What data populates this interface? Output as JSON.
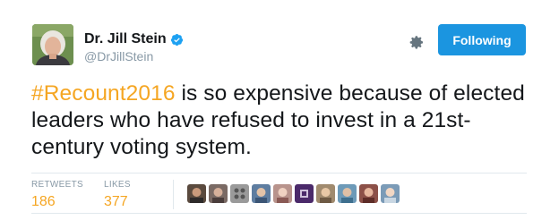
{
  "author": {
    "name": "Dr. Jill Stein",
    "handle": "@DrJillStein",
    "verified": true,
    "avatar_icon": "profile-photo"
  },
  "header": {
    "settings_icon": "gear-icon",
    "follow_label": "Following"
  },
  "tweet": {
    "hashtag": "#Recount2016",
    "text": " is so expensive because of elected leaders who have refused to invest in a 21st-century voting system."
  },
  "stats": {
    "retweets_label": "RETWEETS",
    "retweets_count": "186",
    "likes_label": "LIKES",
    "likes_count": "377"
  },
  "likers": [
    {
      "name": "liker-avatar-1"
    },
    {
      "name": "liker-avatar-2"
    },
    {
      "name": "liker-avatar-3"
    },
    {
      "name": "liker-avatar-4"
    },
    {
      "name": "liker-avatar-5"
    },
    {
      "name": "liker-avatar-6"
    },
    {
      "name": "liker-avatar-7"
    },
    {
      "name": "liker-avatar-8"
    },
    {
      "name": "liker-avatar-9"
    }
  ],
  "colors": {
    "accent": "#f5a623",
    "button": "#1b95e0",
    "muted": "#8899a6",
    "divider": "#e1e8ed"
  }
}
